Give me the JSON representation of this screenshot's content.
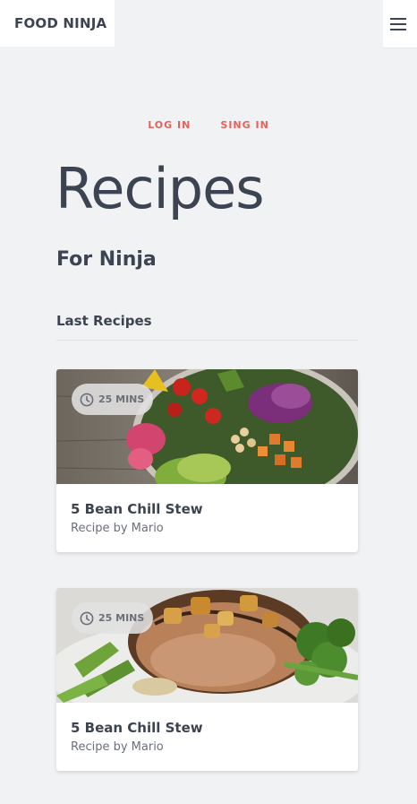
{
  "header": {
    "brand": "FOOD NINJA",
    "menu_icon": "hamburger-menu-icon"
  },
  "auth": {
    "login_label": "LOG IN",
    "signin_label": "SING IN"
  },
  "hero": {
    "title": "Recipes",
    "subtitle": "For Ninja"
  },
  "section": {
    "title": "Last Recipes"
  },
  "recipes": [
    {
      "time": "25 MINS",
      "title": "5 Bean Chill Stew",
      "author": "Recipe by Mario",
      "clock_icon": "clock-icon",
      "image": "salad-bowl-photo"
    },
    {
      "time": "25 MINS",
      "title": "5 Bean Chill Stew",
      "author": "Recipe by Mario",
      "clock_icon": "clock-icon",
      "image": "pork-chop-photo"
    }
  ],
  "colors": {
    "background": "#f1f2f4",
    "accent": "#e8605a",
    "text": "#3d4451"
  }
}
